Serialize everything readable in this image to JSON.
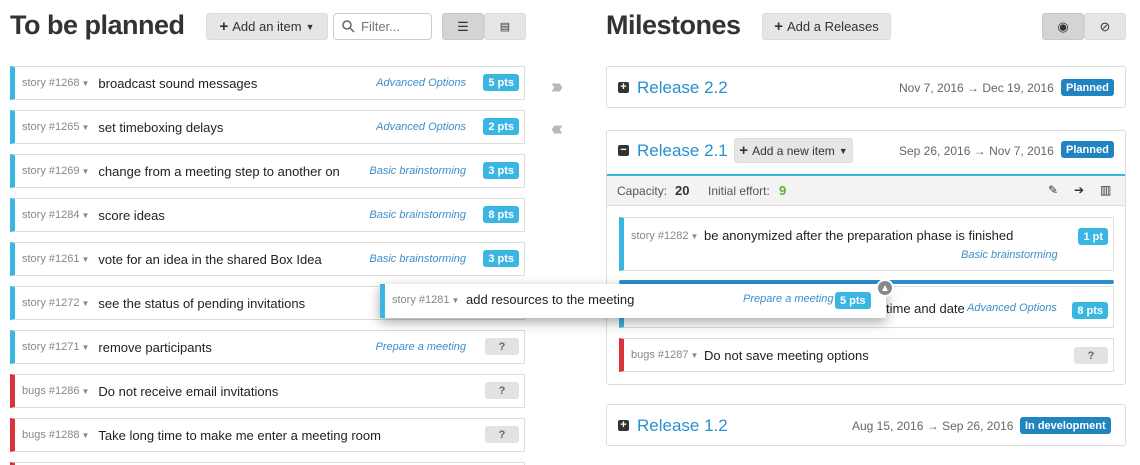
{
  "planned": {
    "title": "To be planned",
    "add_item_label": "Add an item",
    "filter_placeholder": "Filter...",
    "stories": [
      {
        "ref": "story #1268",
        "title": "broadcast sound messages",
        "feature": "Advanced Options",
        "points": "5 pts",
        "type": "story"
      },
      {
        "ref": "story #1265",
        "title": "set timeboxing delays",
        "feature": "Advanced Options",
        "points": "2 pts",
        "type": "story"
      },
      {
        "ref": "story #1269",
        "title": "change from a meeting step to another on",
        "feature": "Basic brainstorming",
        "points": "3 pts",
        "type": "story"
      },
      {
        "ref": "story #1284",
        "title": "score ideas",
        "feature": "Basic brainstorming",
        "points": "8 pts",
        "type": "story"
      },
      {
        "ref": "story #1261",
        "title": "vote for an idea in the shared Box Idea",
        "feature": "Basic brainstorming",
        "points": "3 pts",
        "type": "story"
      },
      {
        "ref": "story #1272",
        "title": "see the status of pending invitations",
        "feature": "",
        "points": "",
        "type": "story"
      },
      {
        "ref": "story #1271",
        "title": "remove participants",
        "feature": "Prepare a meeting",
        "points": "?",
        "type": "story"
      },
      {
        "ref": "bugs #1286",
        "title": "Do not receive email invitations",
        "feature": "",
        "points": "?",
        "type": "bug"
      },
      {
        "ref": "bugs #1288",
        "title": "Take long time to make me enter a meeting room",
        "feature": "",
        "points": "?",
        "type": "bug"
      }
    ]
  },
  "milestones": {
    "title": "Milestones",
    "add_release_label": "Add a Releases",
    "releases": [
      {
        "name": "Release 2.2",
        "dates": "Nov 7, 2016 → Dec 19, 2016",
        "status": "Planned"
      },
      {
        "name": "Release 2.1",
        "dates": "Sep 26, 2016 → Nov 7, 2016",
        "status": "Planned",
        "add_item_label": "Add a new item",
        "capacity_label": "Capacity:",
        "capacity_value": "20",
        "effort_label": "Initial effort:",
        "effort_value": "9",
        "items": [
          {
            "ref": "story #1282",
            "title": "be anonymized after the preparation phase is finished",
            "feature": "Basic brainstorming",
            "points": "1 pt"
          },
          {
            "ref": "",
            "title": "time and date",
            "feature": "Advanced Options",
            "points": "8 pts"
          },
          {
            "ref": "bugs #1287",
            "title": "Do not save meeting options",
            "feature": "",
            "points": "?"
          }
        ]
      },
      {
        "name": "Release 1.2",
        "dates": "Aug 15, 2016 → Sep 26, 2016",
        "status": "In development"
      }
    ]
  },
  "dragged": {
    "ref": "story #1281",
    "title": "add resources to the meeting",
    "feature": "Prepare a meeting",
    "points": "5 pts"
  },
  "colors": {
    "story": "#3ab6e3",
    "bug": "#d9343a",
    "badge": "#1f84c0",
    "link": "#2a8fcf"
  }
}
